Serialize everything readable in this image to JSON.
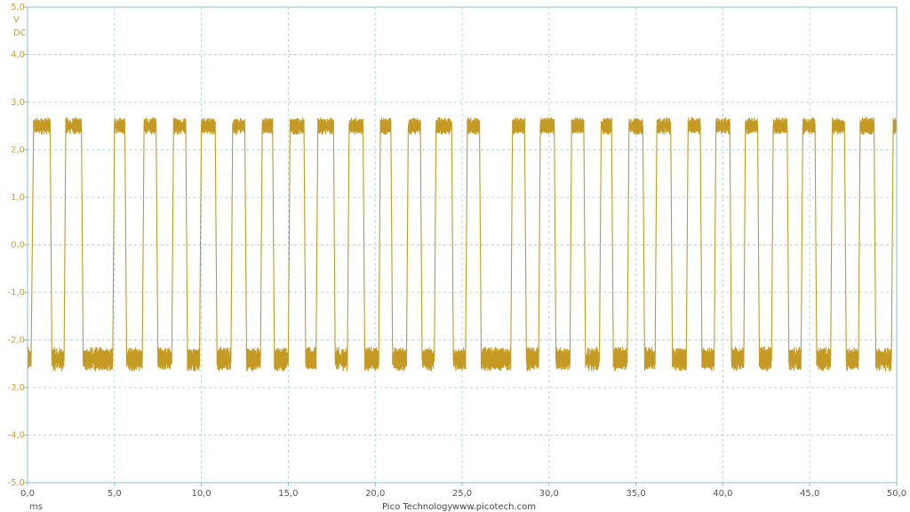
{
  "chart_data": {
    "type": "line",
    "title": "",
    "x_unit": "ms",
    "y_unit": "V",
    "y_coupling": "DC",
    "xlim": [
      0,
      50
    ],
    "ylim": [
      -5,
      5
    ],
    "grid": true,
    "x_ticks": [
      "0,0",
      "5,0",
      "10,0",
      "15,0",
      "20,0",
      "25,0",
      "30,0",
      "35,0",
      "40,0",
      "45,0",
      "50,0"
    ],
    "y_ticks": [
      "5,0",
      "4,0",
      "3,0",
      "2,0",
      "1,0",
      "0,0",
      "-1,0",
      "-2,0",
      "-3,0",
      "-4,0",
      "-5,0"
    ],
    "series": [
      {
        "color": "#c49a22",
        "high_level": 2.5,
        "low_level": -2.4,
        "noise_band": 0.25,
        "x": [
          0.0,
          0.2,
          0.35,
          1.3,
          1.4,
          2.1,
          2.2,
          3.1,
          3.2,
          4.9,
          5.0,
          5.6,
          5.7,
          6.6,
          6.7,
          7.4,
          7.5,
          8.3,
          8.4,
          9.1,
          9.2,
          9.9,
          10.0,
          10.8,
          10.9,
          11.7,
          11.8,
          12.5,
          12.6,
          13.4,
          13.5,
          14.1,
          14.2,
          15.0,
          15.1,
          15.9,
          16.0,
          16.6,
          16.7,
          17.6,
          17.7,
          18.4,
          18.5,
          19.3,
          19.4,
          20.2,
          20.3,
          20.9,
          21.0,
          21.8,
          21.9,
          22.6,
          22.7,
          23.4,
          23.5,
          24.4,
          24.5,
          25.2,
          25.3,
          26.0,
          26.1,
          27.8,
          27.9,
          28.6,
          28.7,
          29.4,
          29.5,
          30.3,
          30.4,
          31.2,
          31.3,
          32.0,
          32.1,
          32.9,
          33.0,
          33.6,
          33.7,
          34.5,
          34.6,
          35.4,
          35.5,
          36.1,
          36.2,
          37.0,
          37.1,
          37.9,
          38.0,
          38.7,
          38.8,
          39.5,
          39.6,
          40.4,
          40.5,
          41.2,
          41.3,
          42.0,
          42.1,
          42.8,
          42.9,
          43.7,
          43.8,
          44.5,
          44.6,
          45.3,
          45.4,
          46.2,
          46.3,
          47.0,
          47.1,
          47.8,
          47.9,
          48.7,
          48.8,
          49.7,
          49.8,
          50.0
        ],
        "levels": [
          "low",
          "low",
          "high",
          "high",
          "low",
          "low",
          "high",
          "high",
          "low",
          "low",
          "high",
          "high",
          "low",
          "low",
          "high",
          "high",
          "low",
          "low",
          "high",
          "high",
          "low",
          "low",
          "high",
          "high",
          "low",
          "low",
          "high",
          "high",
          "low",
          "low",
          "high",
          "high",
          "low",
          "low",
          "high",
          "high",
          "low",
          "low",
          "high",
          "high",
          "low",
          "low",
          "high",
          "high",
          "low",
          "low",
          "high",
          "high",
          "low",
          "low",
          "high",
          "high",
          "low",
          "low",
          "high",
          "high",
          "low",
          "low",
          "high",
          "high",
          "low",
          "low",
          "high",
          "high",
          "low",
          "low",
          "high",
          "high",
          "low",
          "low",
          "high",
          "high",
          "low",
          "low",
          "high",
          "high",
          "low",
          "low",
          "high",
          "high",
          "low",
          "low",
          "high",
          "high",
          "low",
          "low",
          "high",
          "high",
          "low",
          "low",
          "high",
          "high",
          "low",
          "low",
          "high",
          "high",
          "low",
          "low",
          "high",
          "high",
          "low",
          "low",
          "high",
          "high",
          "low",
          "low",
          "high",
          "high",
          "low",
          "low",
          "high",
          "high",
          "low",
          "low",
          "high",
          "high",
          "low",
          "low"
        ]
      }
    ]
  },
  "footer": {
    "brand": "Pico Technology",
    "url": "www.picotech.com"
  },
  "colors": {
    "trace": "#c49a22",
    "y_axis_text": "#c9a332",
    "grid": "#b9d7e0",
    "frame": "#8fbfcc"
  }
}
